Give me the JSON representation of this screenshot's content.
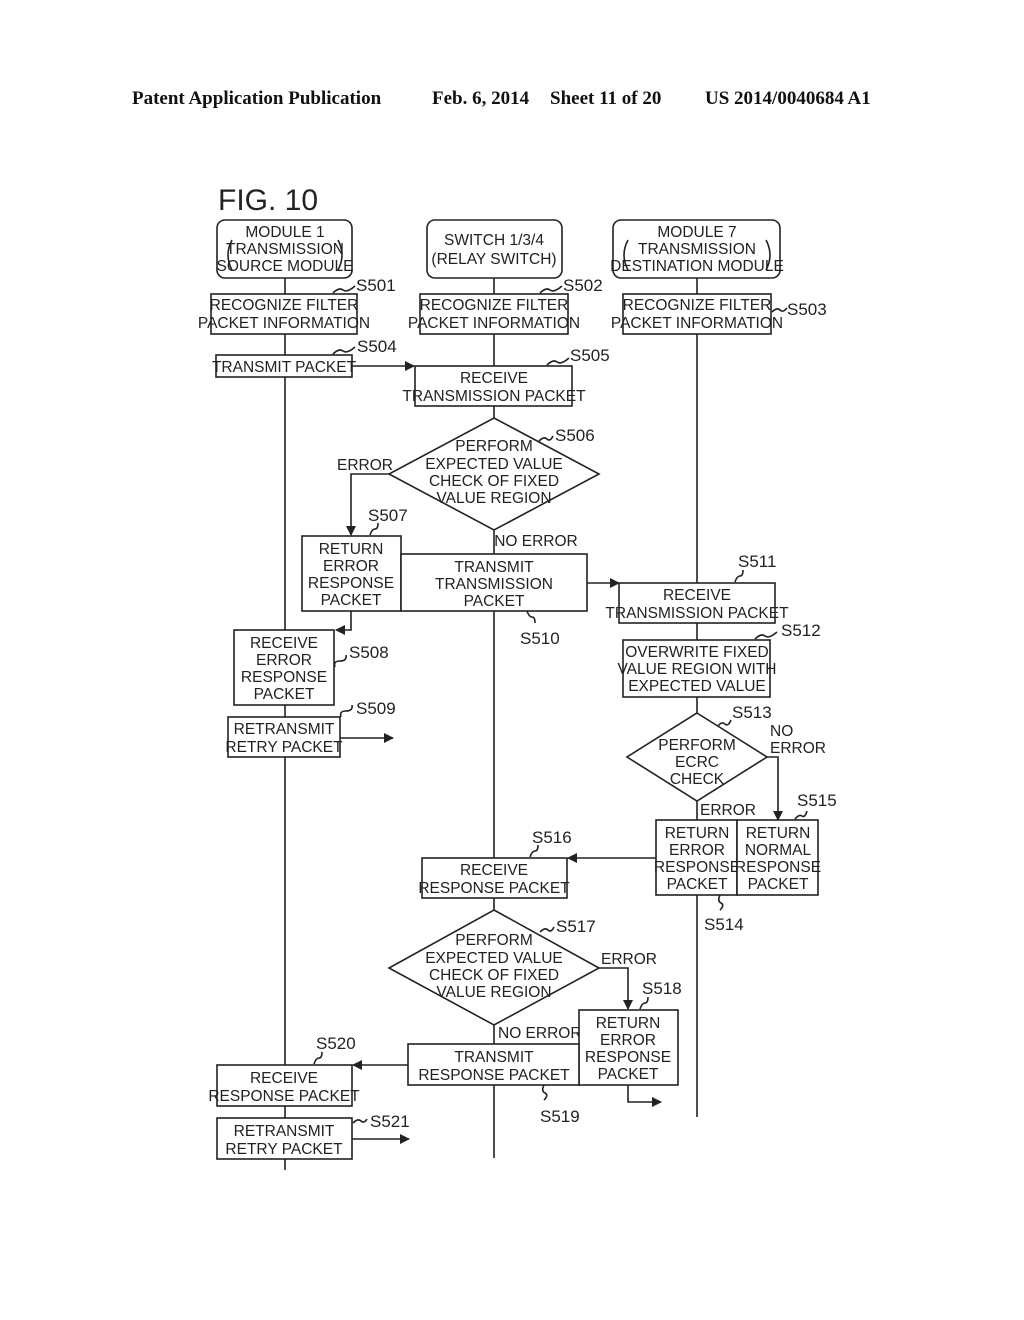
{
  "header": {
    "publication": "Patent Application Publication",
    "date": "Feb. 6, 2014",
    "sheet": "Sheet 11 of 20",
    "number": "US 2014/0040684 A1"
  },
  "figure": {
    "title": "FIG. 10",
    "lanes": [
      {
        "id": "module1",
        "lines": [
          "MODULE 1",
          "TRANSMISSION",
          "SOURCE MODULE"
        ]
      },
      {
        "id": "switch",
        "lines": [
          "SWITCH 1/3/4",
          "(RELAY SWITCH)"
        ]
      },
      {
        "id": "module7",
        "lines": [
          "MODULE 7",
          "TRANSMISSION",
          "DESTINATION MODULE"
        ]
      }
    ],
    "steps": {
      "s501": {
        "id": "S501",
        "lines": [
          "RECOGNIZE FILTER",
          "PACKET INFORMATION"
        ]
      },
      "s502": {
        "id": "S502",
        "lines": [
          "RECOGNIZE FILTER",
          "PACKET INFORMATION"
        ]
      },
      "s503": {
        "id": "S503",
        "lines": [
          "RECOGNIZE FILTER",
          "PACKET INFORMATION"
        ]
      },
      "s504": {
        "id": "S504",
        "lines": [
          "TRANSMIT PACKET"
        ]
      },
      "s505": {
        "id": "S505",
        "lines": [
          "RECEIVE",
          "TRANSMISSION PACKET"
        ]
      },
      "s506": {
        "id": "S506",
        "lines": [
          "PERFORM",
          "EXPECTED VALUE",
          "CHECK OF FIXED",
          "VALUE REGION"
        ]
      },
      "s507": {
        "id": "S507",
        "lines": [
          "RETURN",
          "ERROR",
          "RESPONSE",
          "PACKET"
        ]
      },
      "s508": {
        "id": "S508",
        "lines": [
          "RECEIVE",
          "ERROR",
          "RESPONSE",
          "PACKET"
        ]
      },
      "s509": {
        "id": "S509",
        "lines": [
          "RETRANSMIT",
          "RETRY PACKET"
        ]
      },
      "s510": {
        "id": "S510",
        "lines": [
          "TRANSMIT",
          "TRANSMISSION",
          "PACKET"
        ]
      },
      "s511": {
        "id": "S511",
        "lines": [
          "RECEIVE",
          "TRANSMISSION PACKET"
        ]
      },
      "s512": {
        "id": "S512",
        "lines": [
          "OVERWRITE FIXED",
          "VALUE REGION WITH",
          "EXPECTED VALUE"
        ]
      },
      "s513": {
        "id": "S513",
        "lines": [
          "PERFORM",
          "ECRC",
          "CHECK"
        ]
      },
      "s514": {
        "id": "S514",
        "lines": [
          "RETURN",
          "ERROR",
          "RESPONSE",
          "PACKET"
        ]
      },
      "s515": {
        "id": "S515",
        "lines": [
          "RETURN",
          "NORMAL",
          "RESPONSE",
          "PACKET"
        ]
      },
      "s516": {
        "id": "S516",
        "lines": [
          "RECEIVE",
          "RESPONSE PACKET"
        ]
      },
      "s517": {
        "id": "S517",
        "lines": [
          "PERFORM",
          "EXPECTED VALUE",
          "CHECK OF FIXED",
          "VALUE REGION"
        ]
      },
      "s518": {
        "id": "S518",
        "lines": [
          "RETURN",
          "ERROR",
          "RESPONSE",
          "PACKET"
        ]
      },
      "s519": {
        "id": "S519",
        "lines": [
          "TRANSMIT",
          "RESPONSE PACKET"
        ]
      },
      "s520": {
        "id": "S520",
        "lines": [
          "RECEIVE",
          "RESPONSE PACKET"
        ]
      },
      "s521": {
        "id": "S521",
        "lines": [
          "RETRANSMIT",
          "RETRY PACKET"
        ]
      }
    },
    "branch_labels": {
      "s506_error": "ERROR",
      "s506_no_error": "NO ERROR",
      "s513_no_error": [
        "NO",
        "ERROR"
      ],
      "s513_error": "ERROR",
      "s517_error": "ERROR",
      "s517_no_error": "NO ERROR"
    }
  }
}
